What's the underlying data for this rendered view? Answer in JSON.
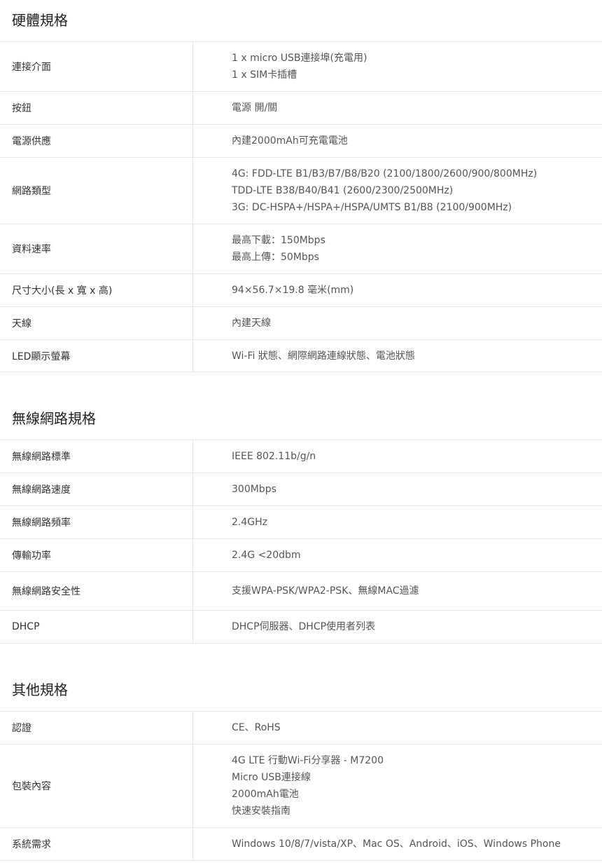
{
  "sections": [
    {
      "title": "硬體規格",
      "rows": [
        {
          "label": "連接介面",
          "values": [
            "1 x micro USB連接埠(充電用)",
            "1 x SIM卡插槽"
          ]
        },
        {
          "label": "按鈕",
          "values": [
            "電源 開/關"
          ]
        },
        {
          "label": "電源供應",
          "values": [
            "內建2000mAh可充電電池"
          ]
        },
        {
          "label": "網路類型",
          "values": [
            "4G: FDD-LTE B1/B3/B7/B8/B20 (2100/1800/2600/900/800MHz)",
            "TDD-LTE B38/B40/B41 (2600/2300/2500MHz)",
            "3G: DC-HSPA+/HSPA+/HSPA/UMTS B1/B8 (2100/900MHz)"
          ]
        },
        {
          "label": "資料速率",
          "values": [
            "最高下載：150Mbps",
            "最高上傳：50Mbps"
          ]
        },
        {
          "label": "尺寸大小(長 x 寬 x 高)",
          "values": [
            "94×56.7×19.8 毫米(mm)"
          ]
        },
        {
          "label": "天線",
          "values": [
            "內建天線"
          ]
        },
        {
          "label": "LED顯示螢幕",
          "values": [
            "Wi-Fi 狀態、網際網路連線狀態、電池狀態"
          ]
        }
      ]
    },
    {
      "title": "無線網路規格",
      "rows": [
        {
          "label": "無線網路標準",
          "values": [
            "IEEE 802.11b/g/n"
          ]
        },
        {
          "label": "無線網路速度",
          "values": [
            "300Mbps"
          ]
        },
        {
          "label": "無線網路頻率",
          "values": [
            "2.4GHz"
          ]
        },
        {
          "label": "傳輸功率",
          "values": [
            "2.4G <20dbm"
          ]
        },
        {
          "label": "無線網路安全性",
          "values": [
            "支援WPA-PSK/WPA2-PSK、無線MAC過濾"
          ]
        },
        {
          "label": "DHCP",
          "values": [
            "DHCP伺服器、DHCP使用者列表"
          ]
        }
      ]
    },
    {
      "title": "其他規格",
      "rows": [
        {
          "label": "認證",
          "values": [
            "CE、RoHS"
          ]
        },
        {
          "label": "包裝內容",
          "values": [
            "4G LTE 行動Wi-Fi分享器 - M7200",
            "Micro USB連接線",
            "2000mAh電池",
            "快速安裝指南"
          ]
        },
        {
          "label": "系統需求",
          "values": [
            "Windows 10/8/7/vista/XP、Mac OS、Android、iOS、Windows Phone"
          ]
        }
      ]
    }
  ]
}
